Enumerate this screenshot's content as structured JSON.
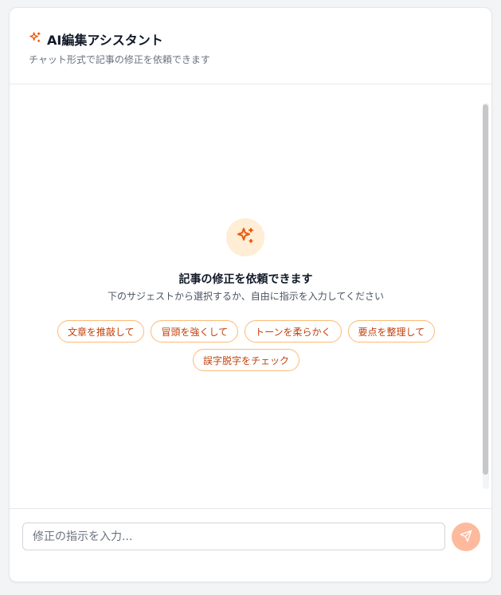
{
  "header": {
    "title": "AI編集アシスタント",
    "subtitle": "チャット形式で記事の修正を依頼できます",
    "icon": "sparkles-icon"
  },
  "empty_state": {
    "icon": "sparkles-icon",
    "title": "記事の修正を依頼できます",
    "description": "下のサジェストから選択するか、自由に指示を入力してください"
  },
  "suggestions": [
    "文章を推敲して",
    "冒頭を強くして",
    "トーンを柔らかく",
    "要点を整理して",
    "誤字脱字をチェック"
  ],
  "input": {
    "placeholder": "修正の指示を入力...",
    "value": ""
  },
  "send_icon": "send-icon",
  "colors": {
    "accent": "#ea580c",
    "chip_border": "#fdba74",
    "chip_text": "#c2410c",
    "icon_bg": "#ffedd5",
    "send_bg": "#fdba9d"
  }
}
